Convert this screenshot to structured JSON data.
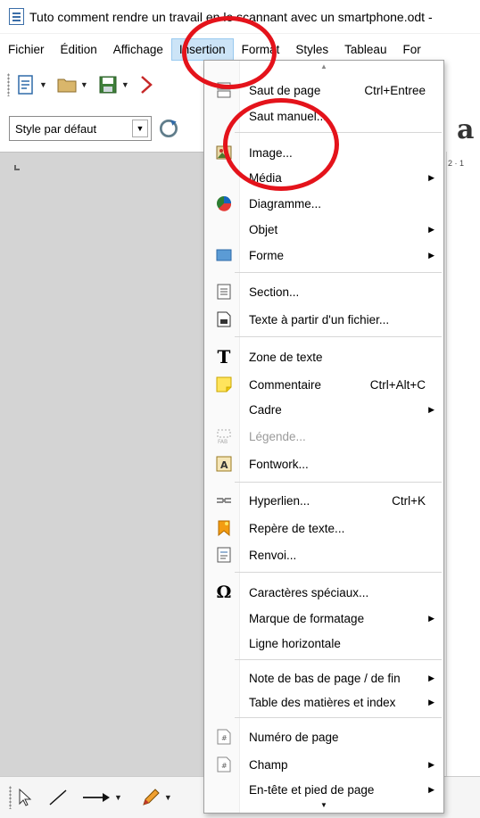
{
  "window": {
    "title": "Tuto comment rendre un travail en le scannant avec un smartphone.odt -"
  },
  "menubar": {
    "items": [
      "Fichier",
      "Édition",
      "Affichage",
      "Insertion",
      "Format",
      "Styles",
      "Tableau",
      "For"
    ]
  },
  "toolbar": {
    "paragraph_style": "Style par défaut"
  },
  "insertion_menu": {
    "items": [
      {
        "label": "Saut de page",
        "shortcut": "Ctrl+Entree",
        "icon": "page-break-icon"
      },
      {
        "label": "Saut manuel...",
        "shortcut": "",
        "icon": ""
      },
      {
        "label": "Image...",
        "shortcut": "",
        "icon": "image-icon"
      },
      {
        "label": "Média",
        "shortcut": "",
        "icon": "",
        "submenu": true
      },
      {
        "label": "Diagramme...",
        "shortcut": "",
        "icon": "chart-icon"
      },
      {
        "label": "Objet",
        "shortcut": "",
        "icon": "",
        "submenu": true
      },
      {
        "label": "Forme",
        "shortcut": "",
        "icon": "shape-icon",
        "submenu": true
      },
      {
        "label": "Section...",
        "shortcut": "",
        "icon": "section-icon"
      },
      {
        "label": "Texte à partir d'un fichier...",
        "shortcut": "",
        "icon": "text-file-icon"
      },
      {
        "label": "Zone de texte",
        "shortcut": "",
        "icon": "text-box-icon"
      },
      {
        "label": "Commentaire",
        "shortcut": "Ctrl+Alt+C",
        "icon": "comment-icon"
      },
      {
        "label": "Cadre",
        "shortcut": "",
        "icon": "",
        "submenu": true
      },
      {
        "label": "Légende...",
        "shortcut": "",
        "icon": "caption-icon",
        "disabled": true
      },
      {
        "label": "Fontwork...",
        "shortcut": "",
        "icon": "fontwork-icon"
      },
      {
        "label": "Hyperlien...",
        "shortcut": "Ctrl+K",
        "icon": "hyperlink-icon"
      },
      {
        "label": "Repère de texte...",
        "shortcut": "",
        "icon": "bookmark-icon"
      },
      {
        "label": "Renvoi...",
        "shortcut": "",
        "icon": "cross-reference-icon"
      },
      {
        "label": "Caractères spéciaux...",
        "shortcut": "",
        "icon": "omega-icon"
      },
      {
        "label": "Marque de formatage",
        "shortcut": "",
        "icon": "",
        "submenu": true
      },
      {
        "label": "Ligne horizontale",
        "shortcut": "",
        "icon": ""
      },
      {
        "label": "Note de bas de page / de fin",
        "shortcut": "",
        "icon": "",
        "submenu": true
      },
      {
        "label": "Table des matières et index",
        "shortcut": "",
        "icon": "",
        "submenu": true
      },
      {
        "label": "Numéro de page",
        "shortcut": "",
        "icon": "page-number-icon"
      },
      {
        "label": "Champ",
        "shortcut": "",
        "icon": "field-icon",
        "submenu": true
      },
      {
        "label": "En-tête et pied de page",
        "shortcut": "",
        "icon": "",
        "submenu": true
      }
    ]
  },
  "colors": {
    "annotation": "#e4131b",
    "menu_highlight": "#cce4f7"
  }
}
